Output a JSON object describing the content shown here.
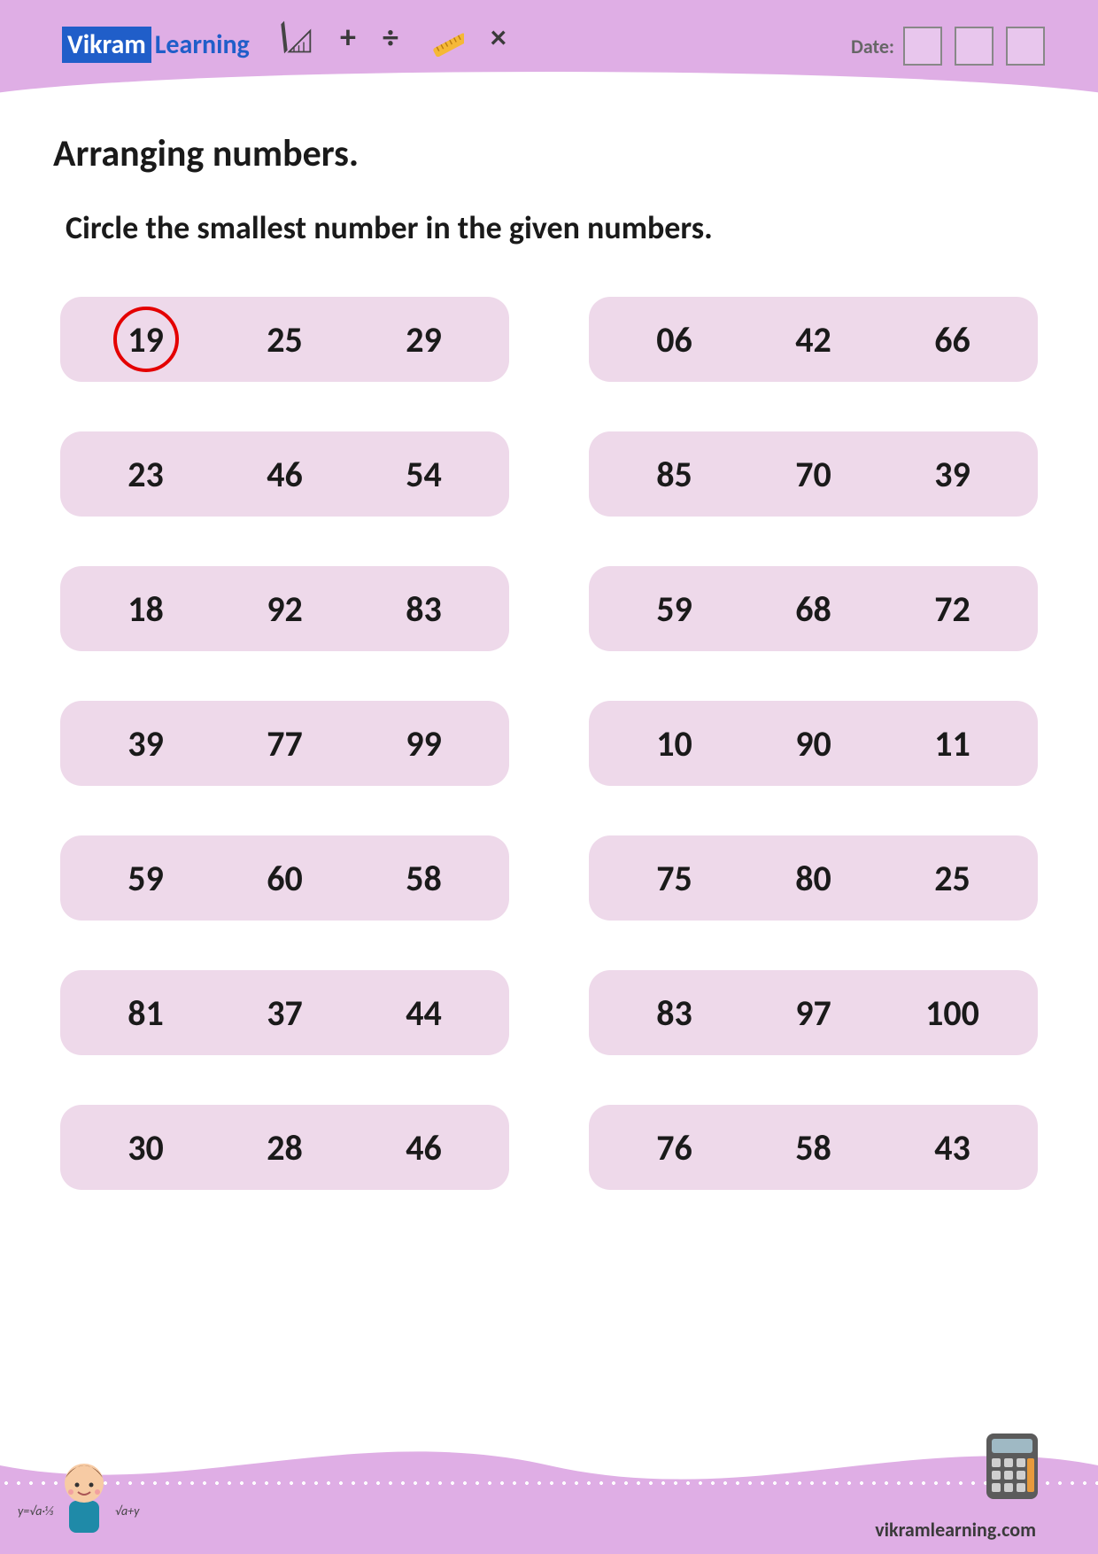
{
  "brand": {
    "part1": "Vikram",
    "part2": "Learning"
  },
  "date_label": "Date:",
  "title": "Arranging numbers.",
  "subtitle": "Circle the smallest number in the given numbers.",
  "rows": [
    {
      "a": "19",
      "b": "25",
      "c": "29",
      "circled": 0
    },
    {
      "a": "06",
      "b": "42",
      "c": "66",
      "circled": -1
    },
    {
      "a": "23",
      "b": "46",
      "c": "54",
      "circled": -1
    },
    {
      "a": "85",
      "b": "70",
      "c": "39",
      "circled": -1
    },
    {
      "a": "18",
      "b": "92",
      "c": "83",
      "circled": -1
    },
    {
      "a": "59",
      "b": "68",
      "c": "72",
      "circled": -1
    },
    {
      "a": "39",
      "b": "77",
      "c": "99",
      "circled": -1
    },
    {
      "a": "10",
      "b": "90",
      "c": "11",
      "circled": -1
    },
    {
      "a": "59",
      "b": "60",
      "c": "58",
      "circled": -1
    },
    {
      "a": "75",
      "b": "80",
      "c": "25",
      "circled": -1
    },
    {
      "a": "81",
      "b": "37",
      "c": "44",
      "circled": -1
    },
    {
      "a": "83",
      "b": "97",
      "c": "100",
      "circled": -1
    },
    {
      "a": "30",
      "b": "28",
      "c": "46",
      "circled": -1
    },
    {
      "a": "76",
      "b": "58",
      "c": "43",
      "circled": -1
    }
  ],
  "footer_url": "vikramlearning.com",
  "symbols": {
    "plus": "+",
    "divide": "÷",
    "times": "×"
  }
}
